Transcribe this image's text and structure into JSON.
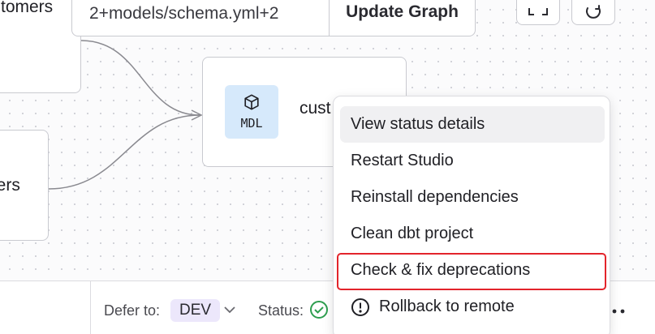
{
  "search": {
    "value": "2+models/schema.yml+2",
    "update_label": "Update Graph"
  },
  "nodes": {
    "customers": "tomers",
    "orders": "lers",
    "main_badge": "MDL",
    "main_name": "cust"
  },
  "toolbar": {
    "expand_icon": "expand-icon",
    "refresh_icon": "refresh-icon"
  },
  "menu": {
    "items": [
      "View status details",
      "Restart Studio",
      "Reinstall dependencies",
      "Clean dbt project",
      "Check & fix deprecations",
      "Rollback to remote"
    ]
  },
  "bottom": {
    "defer_label": "Defer to:",
    "env": "DEV",
    "status_label": "Status:"
  },
  "colors": {
    "badge_bg": "#d6e9fb",
    "env_bg": "#ece7fb",
    "status_ok": "#2e9e4f",
    "highlight": "#e3242b"
  }
}
